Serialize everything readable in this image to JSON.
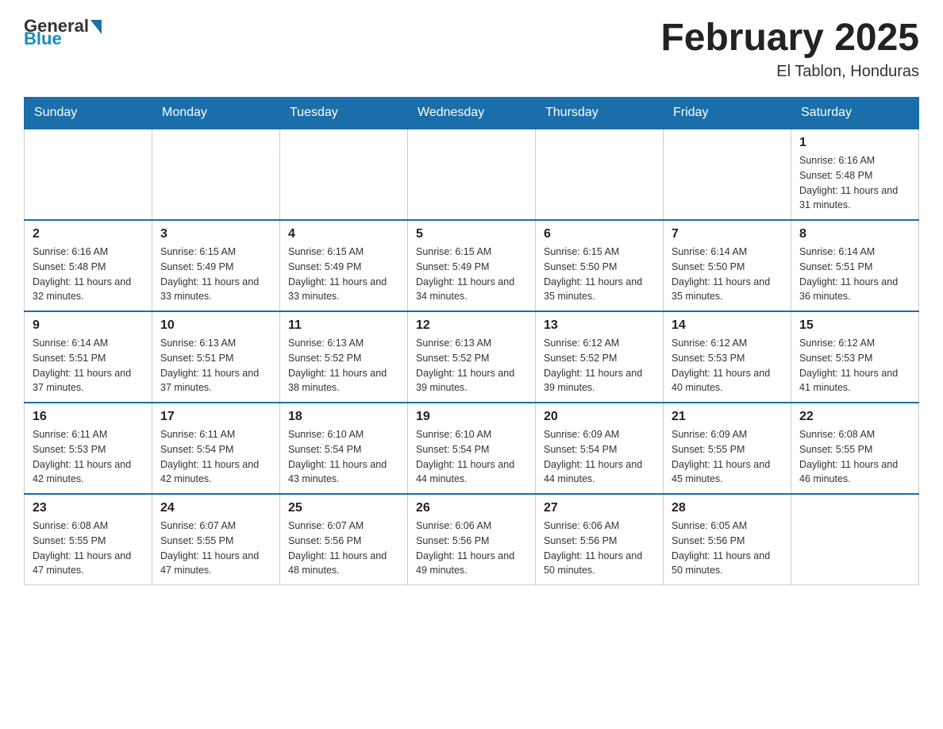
{
  "header": {
    "title": "February 2025",
    "location": "El Tablon, Honduras",
    "logo": {
      "general": "General",
      "blue": "Blue"
    }
  },
  "weekdays": [
    "Sunday",
    "Monday",
    "Tuesday",
    "Wednesday",
    "Thursday",
    "Friday",
    "Saturday"
  ],
  "weeks": [
    [
      {
        "day": "",
        "info": ""
      },
      {
        "day": "",
        "info": ""
      },
      {
        "day": "",
        "info": ""
      },
      {
        "day": "",
        "info": ""
      },
      {
        "day": "",
        "info": ""
      },
      {
        "day": "",
        "info": ""
      },
      {
        "day": "1",
        "info": "Sunrise: 6:16 AM\nSunset: 5:48 PM\nDaylight: 11 hours and 31 minutes."
      }
    ],
    [
      {
        "day": "2",
        "info": "Sunrise: 6:16 AM\nSunset: 5:48 PM\nDaylight: 11 hours and 32 minutes."
      },
      {
        "day": "3",
        "info": "Sunrise: 6:15 AM\nSunset: 5:49 PM\nDaylight: 11 hours and 33 minutes."
      },
      {
        "day": "4",
        "info": "Sunrise: 6:15 AM\nSunset: 5:49 PM\nDaylight: 11 hours and 33 minutes."
      },
      {
        "day": "5",
        "info": "Sunrise: 6:15 AM\nSunset: 5:49 PM\nDaylight: 11 hours and 34 minutes."
      },
      {
        "day": "6",
        "info": "Sunrise: 6:15 AM\nSunset: 5:50 PM\nDaylight: 11 hours and 35 minutes."
      },
      {
        "day": "7",
        "info": "Sunrise: 6:14 AM\nSunset: 5:50 PM\nDaylight: 11 hours and 35 minutes."
      },
      {
        "day": "8",
        "info": "Sunrise: 6:14 AM\nSunset: 5:51 PM\nDaylight: 11 hours and 36 minutes."
      }
    ],
    [
      {
        "day": "9",
        "info": "Sunrise: 6:14 AM\nSunset: 5:51 PM\nDaylight: 11 hours and 37 minutes."
      },
      {
        "day": "10",
        "info": "Sunrise: 6:13 AM\nSunset: 5:51 PM\nDaylight: 11 hours and 37 minutes."
      },
      {
        "day": "11",
        "info": "Sunrise: 6:13 AM\nSunset: 5:52 PM\nDaylight: 11 hours and 38 minutes."
      },
      {
        "day": "12",
        "info": "Sunrise: 6:13 AM\nSunset: 5:52 PM\nDaylight: 11 hours and 39 minutes."
      },
      {
        "day": "13",
        "info": "Sunrise: 6:12 AM\nSunset: 5:52 PM\nDaylight: 11 hours and 39 minutes."
      },
      {
        "day": "14",
        "info": "Sunrise: 6:12 AM\nSunset: 5:53 PM\nDaylight: 11 hours and 40 minutes."
      },
      {
        "day": "15",
        "info": "Sunrise: 6:12 AM\nSunset: 5:53 PM\nDaylight: 11 hours and 41 minutes."
      }
    ],
    [
      {
        "day": "16",
        "info": "Sunrise: 6:11 AM\nSunset: 5:53 PM\nDaylight: 11 hours and 42 minutes."
      },
      {
        "day": "17",
        "info": "Sunrise: 6:11 AM\nSunset: 5:54 PM\nDaylight: 11 hours and 42 minutes."
      },
      {
        "day": "18",
        "info": "Sunrise: 6:10 AM\nSunset: 5:54 PM\nDaylight: 11 hours and 43 minutes."
      },
      {
        "day": "19",
        "info": "Sunrise: 6:10 AM\nSunset: 5:54 PM\nDaylight: 11 hours and 44 minutes."
      },
      {
        "day": "20",
        "info": "Sunrise: 6:09 AM\nSunset: 5:54 PM\nDaylight: 11 hours and 44 minutes."
      },
      {
        "day": "21",
        "info": "Sunrise: 6:09 AM\nSunset: 5:55 PM\nDaylight: 11 hours and 45 minutes."
      },
      {
        "day": "22",
        "info": "Sunrise: 6:08 AM\nSunset: 5:55 PM\nDaylight: 11 hours and 46 minutes."
      }
    ],
    [
      {
        "day": "23",
        "info": "Sunrise: 6:08 AM\nSunset: 5:55 PM\nDaylight: 11 hours and 47 minutes."
      },
      {
        "day": "24",
        "info": "Sunrise: 6:07 AM\nSunset: 5:55 PM\nDaylight: 11 hours and 47 minutes."
      },
      {
        "day": "25",
        "info": "Sunrise: 6:07 AM\nSunset: 5:56 PM\nDaylight: 11 hours and 48 minutes."
      },
      {
        "day": "26",
        "info": "Sunrise: 6:06 AM\nSunset: 5:56 PM\nDaylight: 11 hours and 49 minutes."
      },
      {
        "day": "27",
        "info": "Sunrise: 6:06 AM\nSunset: 5:56 PM\nDaylight: 11 hours and 50 minutes."
      },
      {
        "day": "28",
        "info": "Sunrise: 6:05 AM\nSunset: 5:56 PM\nDaylight: 11 hours and 50 minutes."
      },
      {
        "day": "",
        "info": ""
      }
    ]
  ]
}
